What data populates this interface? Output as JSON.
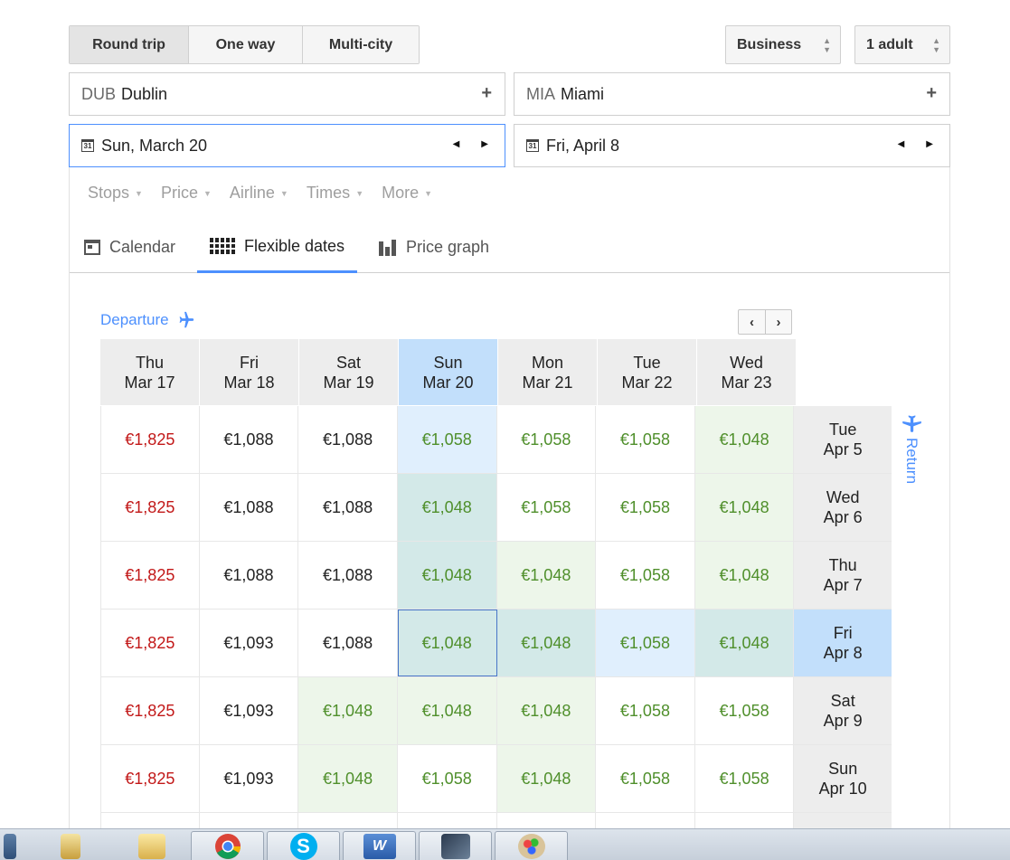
{
  "trip_type": {
    "options": [
      "Round trip",
      "One way",
      "Multi-city"
    ],
    "selected": "Round trip"
  },
  "cabin_class": "Business",
  "passengers": "1 adult",
  "origin": {
    "code": "DUB",
    "city": "Dublin"
  },
  "destination": {
    "code": "MIA",
    "city": "Miami"
  },
  "depart_date": "Sun, March 20",
  "return_date": "Fri, April 8",
  "calendar_icon_text": "31",
  "filters": [
    "Stops",
    "Price",
    "Airline",
    "Times",
    "More"
  ],
  "views": {
    "calendar": "Calendar",
    "flexible": "Flexible dates",
    "graph": "Price graph",
    "active": "flexible"
  },
  "departure_label": "Departure",
  "return_label": "Return",
  "colors": {
    "accent": "#4d90fe",
    "cheap": "#4f8f2b",
    "expensive": "#c21818"
  },
  "grid": {
    "columns": [
      {
        "day": "Thu",
        "date": "Mar 17"
      },
      {
        "day": "Fri",
        "date": "Mar 18"
      },
      {
        "day": "Sat",
        "date": "Mar 19"
      },
      {
        "day": "Sun",
        "date": "Mar 20",
        "selected": true
      },
      {
        "day": "Mon",
        "date": "Mar 21"
      },
      {
        "day": "Tue",
        "date": "Mar 22"
      },
      {
        "day": "Wed",
        "date": "Mar 23"
      }
    ],
    "rows": [
      {
        "day": "Tue",
        "date": "Apr 5",
        "cells": [
          {
            "p": "€1,825",
            "c": "red"
          },
          {
            "p": "€1,088"
          },
          {
            "p": "€1,088"
          },
          {
            "p": "€1,058",
            "c": "green",
            "bg": "lb"
          },
          {
            "p": "€1,058",
            "c": "green"
          },
          {
            "p": "€1,058",
            "c": "green"
          },
          {
            "p": "€1,048",
            "c": "green",
            "bg": "lg"
          }
        ]
      },
      {
        "day": "Wed",
        "date": "Apr 6",
        "cells": [
          {
            "p": "€1,825",
            "c": "red"
          },
          {
            "p": "€1,088"
          },
          {
            "p": "€1,088"
          },
          {
            "p": "€1,048",
            "c": "green",
            "bg": "tl"
          },
          {
            "p": "€1,058",
            "c": "green"
          },
          {
            "p": "€1,058",
            "c": "green"
          },
          {
            "p": "€1,048",
            "c": "green",
            "bg": "lg"
          }
        ]
      },
      {
        "day": "Thu",
        "date": "Apr 7",
        "cells": [
          {
            "p": "€1,825",
            "c": "red"
          },
          {
            "p": "€1,088"
          },
          {
            "p": "€1,088"
          },
          {
            "p": "€1,048",
            "c": "green",
            "bg": "tl"
          },
          {
            "p": "€1,048",
            "c": "green",
            "bg": "lg"
          },
          {
            "p": "€1,058",
            "c": "green"
          },
          {
            "p": "€1,048",
            "c": "green",
            "bg": "lg"
          }
        ]
      },
      {
        "day": "Fri",
        "date": "Apr 8",
        "selected": true,
        "cells": [
          {
            "p": "€1,825",
            "c": "red"
          },
          {
            "p": "€1,093"
          },
          {
            "p": "€1,088"
          },
          {
            "p": "€1,048",
            "c": "green",
            "bg": "tl",
            "outlined": true
          },
          {
            "p": "€1,048",
            "c": "green",
            "bg": "tl"
          },
          {
            "p": "€1,058",
            "c": "green",
            "bg": "lb"
          },
          {
            "p": "€1,048",
            "c": "green",
            "bg": "tl"
          }
        ]
      },
      {
        "day": "Sat",
        "date": "Apr 9",
        "cells": [
          {
            "p": "€1,825",
            "c": "red"
          },
          {
            "p": "€1,093"
          },
          {
            "p": "€1,048",
            "c": "green",
            "bg": "lg"
          },
          {
            "p": "€1,048",
            "c": "green",
            "bg": "lg"
          },
          {
            "p": "€1,048",
            "c": "green",
            "bg": "lg"
          },
          {
            "p": "€1,058",
            "c": "green"
          },
          {
            "p": "€1,058",
            "c": "green"
          }
        ]
      },
      {
        "day": "Sun",
        "date": "Apr 10",
        "cells": [
          {
            "p": "€1,825",
            "c": "red"
          },
          {
            "p": "€1,093"
          },
          {
            "p": "€1,048",
            "c": "green",
            "bg": "lg"
          },
          {
            "p": "€1,058",
            "c": "green"
          },
          {
            "p": "€1,048",
            "c": "green",
            "bg": "lg"
          },
          {
            "p": "€1,058",
            "c": "green"
          },
          {
            "p": "€1,058",
            "c": "green"
          }
        ]
      }
    ]
  },
  "taskbar": [
    "explorer-icon",
    "documents-icon",
    "folder-icon",
    "chrome-icon",
    "skype-icon",
    "word-icon",
    "app-icon",
    "paint-icon"
  ]
}
